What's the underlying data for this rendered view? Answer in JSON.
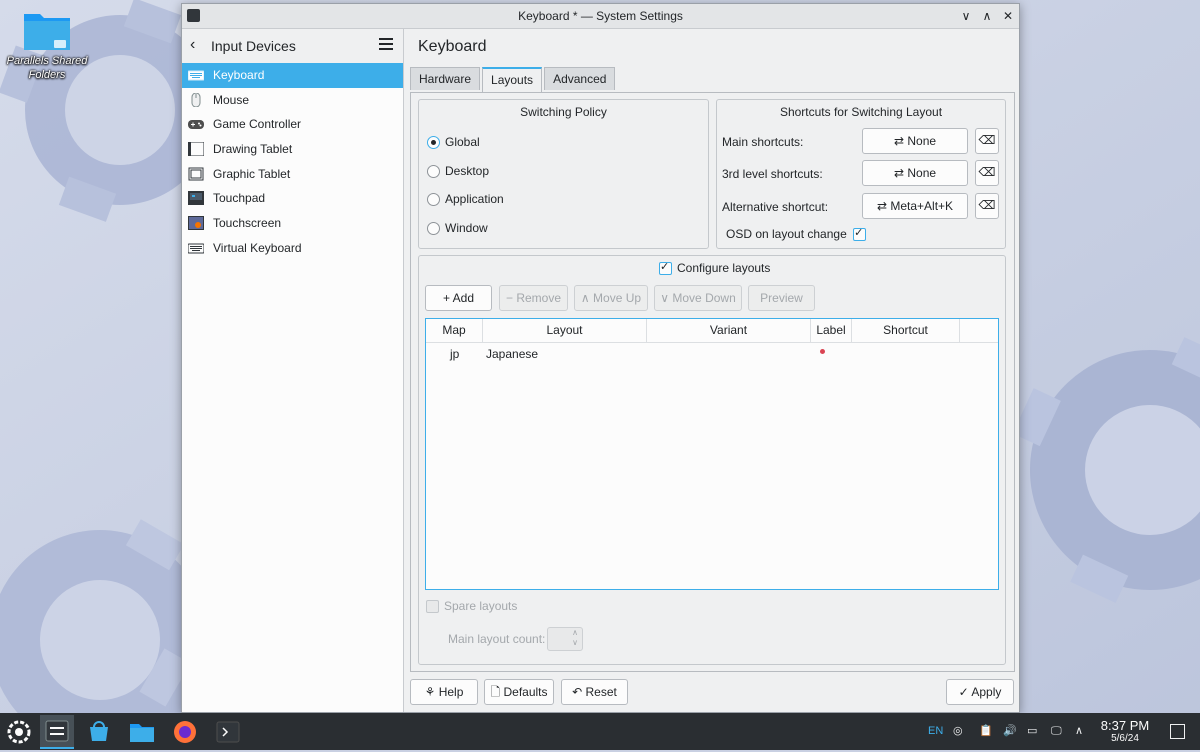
{
  "desktop": {
    "icon_label": "Parallels Shared Folders"
  },
  "window": {
    "title": "Keyboard * — System Settings"
  },
  "sidebar": {
    "back_title": "Input Devices",
    "items": [
      {
        "label": "Keyboard",
        "icon": "keyboard-icon",
        "active": true
      },
      {
        "label": "Mouse",
        "icon": "mouse-icon"
      },
      {
        "label": "Game Controller",
        "icon": "gamepad-icon"
      },
      {
        "label": "Drawing Tablet",
        "icon": "drawing-tablet-icon"
      },
      {
        "label": "Graphic Tablet",
        "icon": "graphic-tablet-icon"
      },
      {
        "label": "Touchpad",
        "icon": "touchpad-icon"
      },
      {
        "label": "Touchscreen",
        "icon": "touchscreen-icon"
      },
      {
        "label": "Virtual Keyboard",
        "icon": "virtual-keyboard-icon"
      }
    ]
  },
  "page": {
    "title": "Keyboard",
    "tabs": [
      "Hardware",
      "Layouts",
      "Advanced"
    ],
    "active_tab": "Layouts"
  },
  "switching_policy": {
    "title": "Switching Policy",
    "options": [
      "Global",
      "Desktop",
      "Application",
      "Window"
    ],
    "selected": "Global"
  },
  "shortcuts": {
    "title": "Shortcuts for Switching Layout",
    "rows": [
      {
        "label": "Main shortcuts:",
        "value": "None"
      },
      {
        "label": "3rd level shortcuts:",
        "value": "None"
      },
      {
        "label": "Alternative shortcut:",
        "value": "Meta+Alt+K"
      }
    ],
    "osd_label": "OSD on layout change",
    "osd_checked": true
  },
  "layouts": {
    "configure_label": "Configure layouts",
    "configure_checked": true,
    "toolbar": {
      "add": "Add",
      "remove": "Remove",
      "move_up": "Move Up",
      "move_down": "Move Down",
      "preview": "Preview"
    },
    "columns": [
      "Map",
      "Layout",
      "Variant",
      "Label",
      "Shortcut"
    ],
    "rows": [
      {
        "map": "jp",
        "layout": "Japanese",
        "variant": "",
        "label": "",
        "shortcut": ""
      }
    ],
    "spare_layouts_label": "Spare layouts",
    "main_layout_count_label": "Main layout count:"
  },
  "footer": {
    "help": "Help",
    "defaults": "Defaults",
    "reset": "Reset",
    "apply": "Apply"
  },
  "taskbar": {
    "language": "EN",
    "time": "8:37 PM",
    "date": "5/6/24"
  },
  "colors": {
    "accent": "#3daee9",
    "taskbar": "#2a2e32",
    "window_bg": "#eff0f1",
    "label_dot": "#da4453"
  }
}
